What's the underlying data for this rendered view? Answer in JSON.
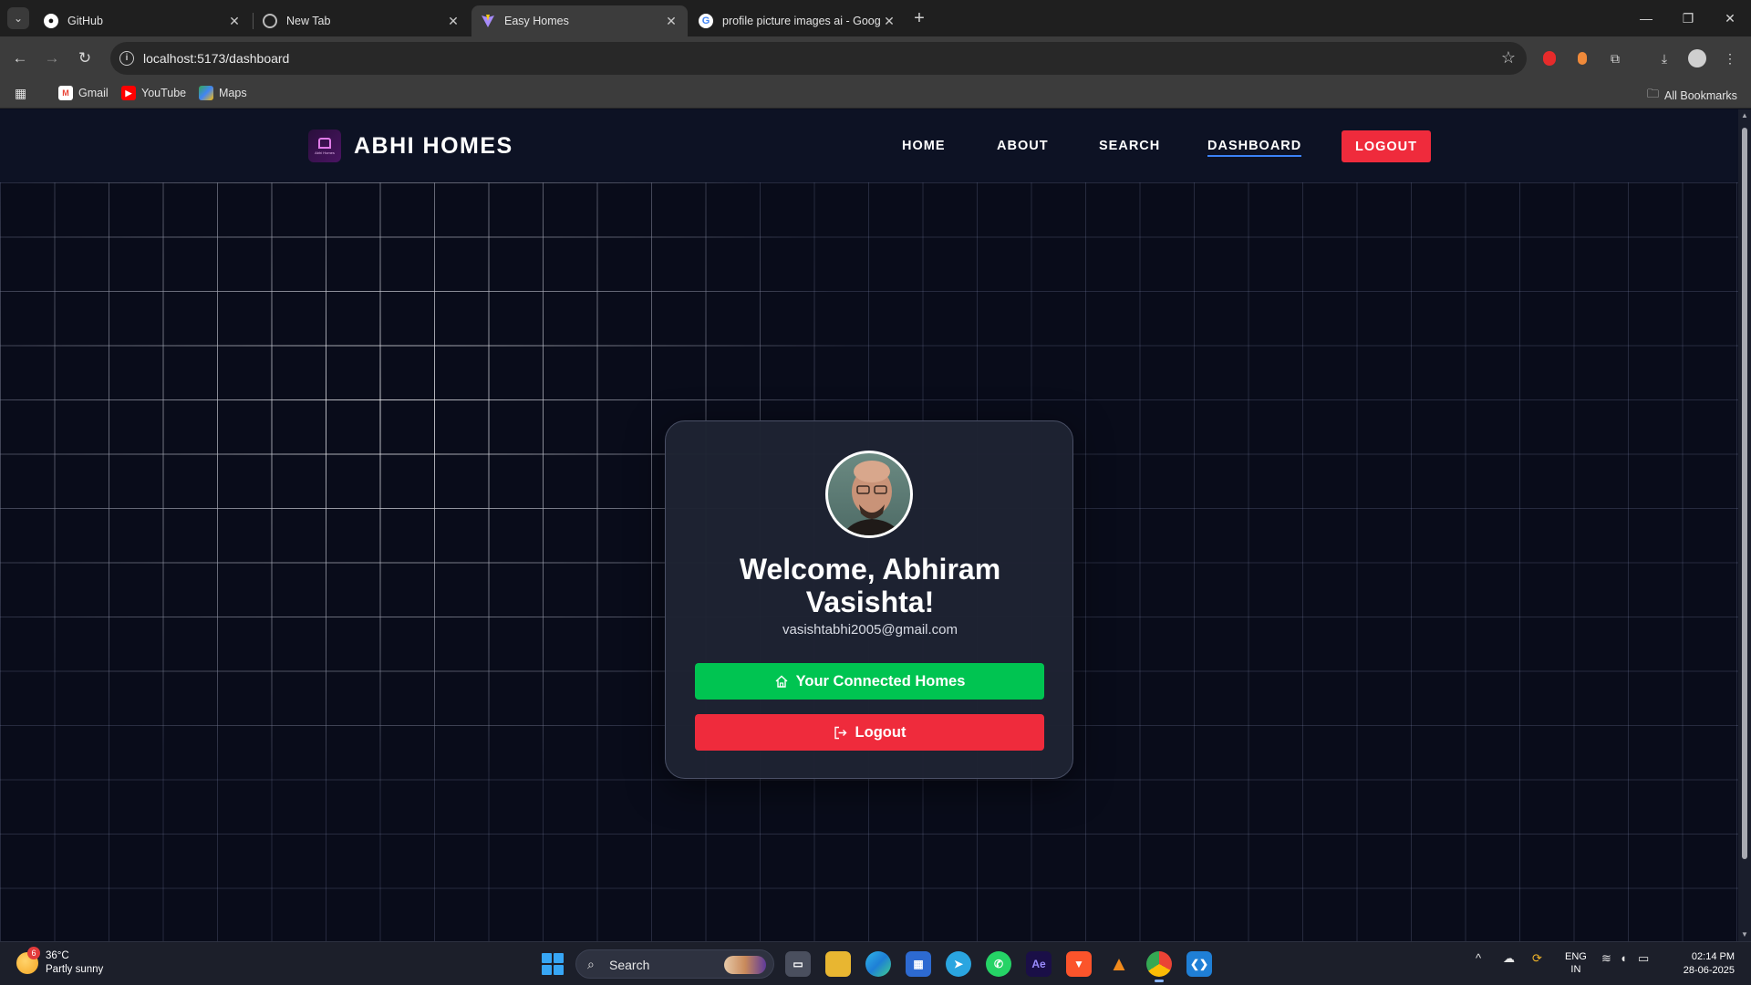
{
  "browser": {
    "tabs": [
      {
        "title": "GitHub",
        "icon": "github-icon"
      },
      {
        "title": "New Tab",
        "icon": "chrome-icon"
      },
      {
        "title": "Easy Homes",
        "icon": "vite-icon",
        "active": true
      },
      {
        "title": "profile picture images ai - Goog",
        "icon": "google-icon"
      }
    ],
    "url": "localhost:5173/dashboard",
    "bookmarks": [
      {
        "label": "Gmail",
        "icon": "gmail-icon"
      },
      {
        "label": "YouTube",
        "icon": "youtube-icon"
      },
      {
        "label": "Maps",
        "icon": "maps-icon"
      }
    ],
    "all_bookmarks_label": "All Bookmarks"
  },
  "site": {
    "brand": "ABHI HOMES",
    "logo_text": "Abhi Homes",
    "nav": [
      {
        "label": "HOME"
      },
      {
        "label": "ABOUT"
      },
      {
        "label": "SEARCH"
      },
      {
        "label": "DASHBOARD",
        "active": true
      }
    ],
    "logout_label": "LOGOUT",
    "accent_color": "#ef2b3c",
    "active_underline_color": "#3b82f6"
  },
  "card": {
    "welcome": "Welcome, Abhiram Vasishta!",
    "email": "vasishtabhi2005@gmail.com",
    "homes_button": "Your Connected Homes",
    "logout_button": "Logout",
    "homes_color": "#00c451",
    "logout_color": "#ef2b3c"
  },
  "taskbar": {
    "weather_temp": "36°C",
    "weather_desc": "Partly sunny",
    "weather_badge": "6",
    "search_label": "Search",
    "lang_top": "ENG",
    "lang_bottom": "IN",
    "time": "02:14 PM",
    "date": "28-06-2025"
  }
}
